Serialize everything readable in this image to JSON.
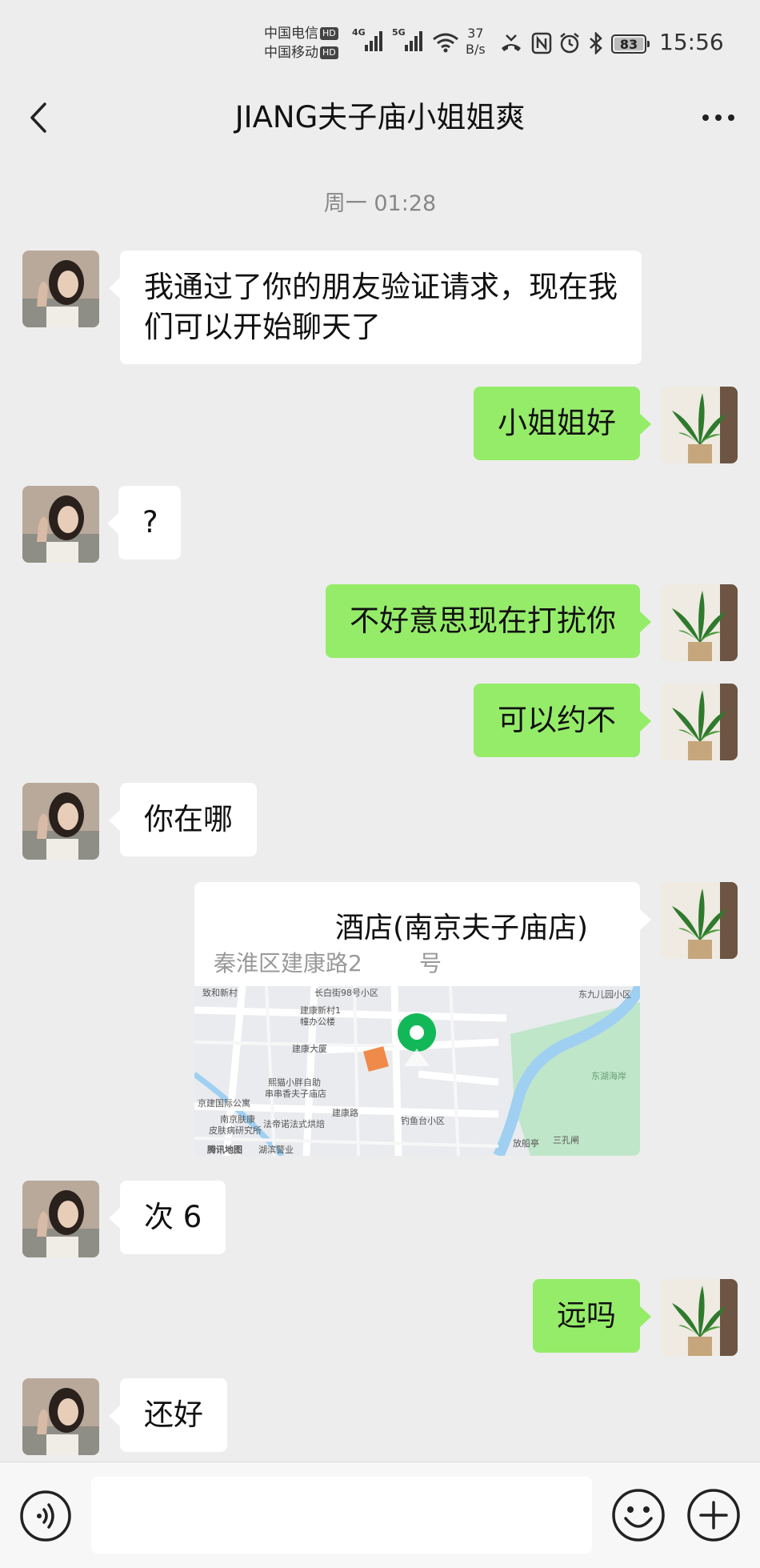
{
  "status_bar": {
    "carrier_1": "中国电信",
    "carrier_2": "中国移动",
    "hd_badge": "HD",
    "network_1": "4G",
    "network_2": "5G",
    "speed_value": "37",
    "speed_unit": "B/s",
    "battery": "83",
    "time": "15:56",
    "icons": [
      "signal-icon",
      "wifi-icon",
      "missed-call-icon",
      "nfc-icon",
      "alarm-icon",
      "bluetooth-icon",
      "battery-icon"
    ]
  },
  "nav": {
    "title": "JIANG夫子庙小姐姐爽",
    "back_icon": "chevron-left-icon",
    "more_icon": "more-icon"
  },
  "chat": {
    "timestamp": "周一 01:28",
    "messages": [
      {
        "side": "left",
        "text": "我通过了你的朋友验证请求，现在我们可以开始聊天了"
      },
      {
        "side": "right",
        "text": "小姐姐好"
      },
      {
        "side": "left",
        "text": "?"
      },
      {
        "side": "right",
        "text": "不好意思现在打扰你"
      },
      {
        "side": "right",
        "text": "可以约不"
      },
      {
        "side": "left",
        "text": "你在哪"
      },
      {
        "side": "right",
        "type": "location"
      },
      {
        "side": "left",
        "text": "次 6"
      },
      {
        "side": "right",
        "text": "远吗"
      },
      {
        "side": "left",
        "text": "还好"
      }
    ],
    "location": {
      "title": "酒店(南京夫子庙店)",
      "address": "秦淮区建康路2        号",
      "map_labels": [
        "致和新村",
        "长白街98号小区",
        "东九儿园小区",
        "建康新村1",
        "幢办公楼",
        "建康大厦",
        "熙猫小胖自助",
        "串串香夫子庙店",
        "京建国际公寓",
        "南京肤康",
        "皮肤病研究所",
        "法帝诺法式烘焙",
        "建康路",
        "钓鱼台小区",
        "放船亭",
        "三孔闸",
        "湖滨警业",
        "腾讯地图",
        "东湖海岸"
      ]
    }
  },
  "input_bar": {
    "voice_icon": "voice-icon",
    "emoji_icon": "emoji-icon",
    "plus_icon": "plus-icon",
    "placeholder": ""
  },
  "colors": {
    "background": "#ededed",
    "bubble_self": "#95ec69",
    "bubble_other": "#ffffff",
    "map_pin": "#12b858"
  }
}
